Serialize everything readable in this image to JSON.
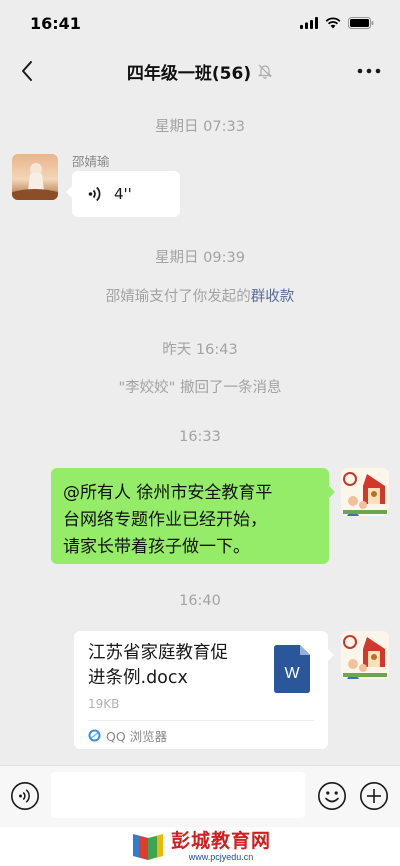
{
  "status": {
    "time": "16:41"
  },
  "header": {
    "title": "四年级一班(56)"
  },
  "messages": {
    "time1": "星期日 07:33",
    "sender1": "邵婧瑜",
    "voice_duration": "4''",
    "time2": "星期日 09:39",
    "payment_prefix": "邵婧瑜支付了你发起的",
    "payment_link": "群收款",
    "time3": "昨天 16:43",
    "recall_notice": "\"李姣姣\" 撤回了一条消息",
    "time4": "16:33",
    "green_line1": "@所有人 徐州市安全教育平",
    "green_line2": "台网络专题作业已经开始，",
    "green_line3": "请家长带着孩子做一下。",
    "time5": "16:40"
  },
  "file": {
    "name_line1": "江苏省家庭教育促",
    "name_line2": "进条例.docx",
    "size": "19KB",
    "source": "QQ 浏览器",
    "icon_letter": "W"
  },
  "input": {
    "placeholder": ""
  },
  "watermark": {
    "name": "彭城教育网",
    "url": "www.pcjyedu.cn"
  },
  "colors": {
    "background": "#ededed",
    "sent_bubble": "#95ec69",
    "link": "#576b95",
    "word_icon": "#2b579a",
    "watermark_red": "#d11f1f"
  },
  "icons": [
    "back-arrow-icon",
    "mute-bell-icon",
    "more-icon",
    "voice-wave-icon",
    "word-file-icon",
    "qq-browser-icon",
    "voice-toggle-icon",
    "emoji-icon",
    "plus-icon"
  ]
}
